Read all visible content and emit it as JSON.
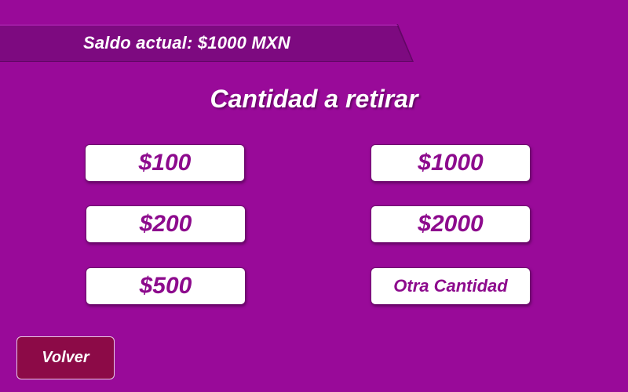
{
  "balance": {
    "label": "Saldo actual: $1000 MXN"
  },
  "heading": {
    "title": "Cantidad a retirar"
  },
  "amounts": {
    "left": [
      "$100",
      "$200",
      "$500"
    ],
    "right": [
      "$1000",
      "$2000",
      "Otra Cantidad"
    ]
  },
  "back": {
    "label": "Volver"
  },
  "colors": {
    "background": "#990a99",
    "ribbon": "#7d0a80",
    "button_text": "#8d0b8d",
    "back_button": "#8c0a47"
  }
}
